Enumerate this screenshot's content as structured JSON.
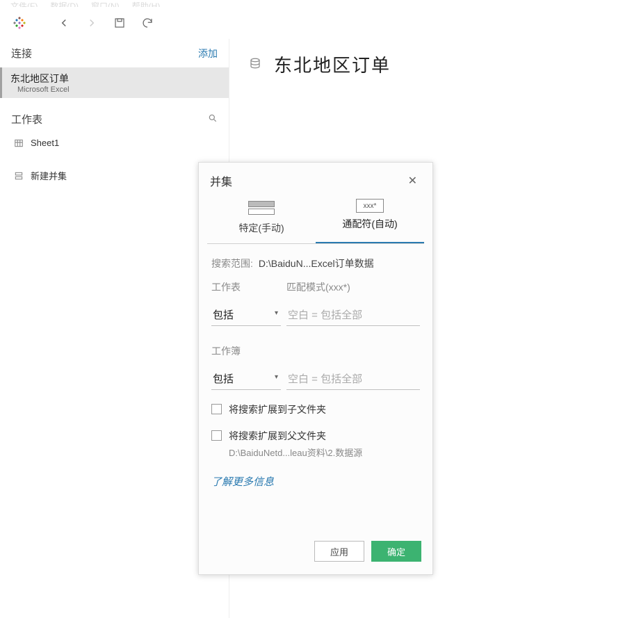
{
  "menubar": [
    "文件(F)",
    "数据(D)",
    "窗口(N)",
    "帮助(H)"
  ],
  "sidebar": {
    "connections_header": "连接",
    "add_link": "添加",
    "connection": {
      "title": "东北地区订单",
      "subtitle": "Microsoft Excel"
    },
    "worksheets_header": "工作表",
    "sheet_item": "Sheet1",
    "new_union": "新建并集"
  },
  "datasource": {
    "title": "东北地区订单"
  },
  "dialog": {
    "title": "并集",
    "tabs": {
      "manual": "特定(手动)",
      "wildcard": "通配符(自动)",
      "wildcard_hint": "xxx*"
    },
    "search_scope_label": "搜索范围:",
    "search_scope_value": "D:\\BaiduN...Excel订单数据",
    "worksheet_label": "工作表",
    "pattern_label": "匹配模式(xxx*)",
    "include_option": "包括",
    "blank_placeholder": "空白 = 包括全部",
    "workbook_label": "工作簿",
    "expand_sub": "将搜索扩展到子文件夹",
    "expand_parent": "将搜索扩展到父文件夹",
    "expand_parent_path": "D:\\BaiduNetd...leau资料\\2.数据源",
    "learn_more": "了解更多信息",
    "apply": "应用",
    "ok": "确定"
  }
}
